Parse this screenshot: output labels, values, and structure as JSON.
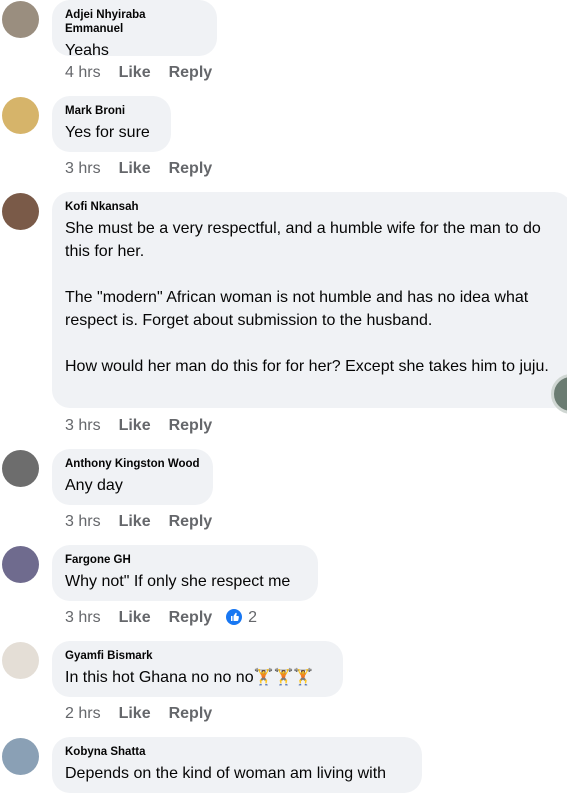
{
  "comments": [
    {
      "author": "Adjei Nhyiraba Emmanuel",
      "text": "Yeahs",
      "time": "4 hrs",
      "like": "Like",
      "reply": "Reply",
      "avatar_color": "#9a8e7f"
    },
    {
      "author": "Mark Broni",
      "text": "Yes for sure",
      "time": "3 hrs",
      "like": "Like",
      "reply": "Reply",
      "avatar_color": "#d6b46a"
    },
    {
      "author": "Kofi Nkansah",
      "text": "She must be a very respectful, and a humble wife for the man to do this for her.\n\nThe \"modern\" African woman is not humble and has no idea what respect is. Forget about submission to the husband.\n\nHow would her man do this for for her? Except she takes him to juju.",
      "time": "3 hrs",
      "like": "Like",
      "reply": "Reply",
      "avatar_color": "#7a5a48"
    },
    {
      "author": "Anthony Kingston Wood",
      "text": "Any day",
      "time": "3 hrs",
      "like": "Like",
      "reply": "Reply",
      "avatar_color": "#6d6d6d"
    },
    {
      "author": "Fargone GH",
      "text": "Why not\" If only she respect me",
      "time": "3 hrs",
      "like": "Like",
      "reply": "Reply",
      "reaction_count": "2",
      "avatar_color": "#6f6b8e"
    },
    {
      "author": "Gyamfi Bismark",
      "text": "In this hot Ghana no no no🏋🏋🏋",
      "time": "2 hrs",
      "like": "Like",
      "reply": "Reply",
      "avatar_color": "#e4ded6"
    },
    {
      "author": "Kobyna Shatta",
      "text": "Depends on the kind of woman am living with",
      "avatar_color": "#8aa0b5"
    }
  ]
}
